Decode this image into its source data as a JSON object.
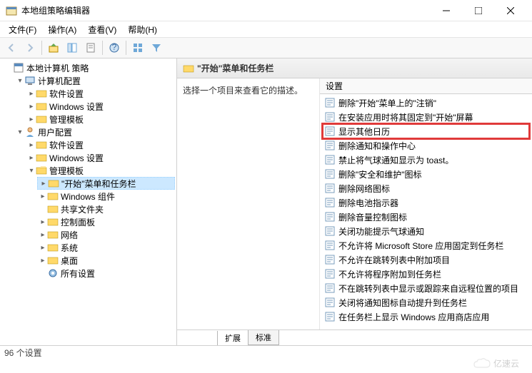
{
  "window": {
    "title": "本地组策略编辑器"
  },
  "menubar": {
    "file": "文件(F)",
    "action": "操作(A)",
    "view": "查看(V)",
    "help": "帮助(H)"
  },
  "tree": {
    "root": "本地计算机 策略",
    "computer_config": "计算机配置",
    "cc_software": "软件设置",
    "cc_windows": "Windows 设置",
    "cc_templates": "管理模板",
    "user_config": "用户配置",
    "uc_software": "软件设置",
    "uc_windows": "Windows 设置",
    "uc_templates": "管理模板",
    "start_taskbar": "\"开始\"菜单和任务栏",
    "windows_components": "Windows 组件",
    "shared_folders": "共享文件夹",
    "control_panel": "控制面板",
    "network": "网络",
    "system": "系统",
    "desktop": "桌面",
    "all_settings": "所有设置"
  },
  "right": {
    "header": "\"开始\"菜单和任务栏",
    "description_prompt": "选择一个项目来查看它的描述。",
    "column_header": "设置",
    "tabs": {
      "extended": "扩展",
      "standard": "标准"
    }
  },
  "settings_list": [
    "删除\"开始\"菜单上的\"注销\"",
    "在安装应用时将其固定到\"开始\"屏幕",
    "显示其他日历",
    "删除通知和操作中心",
    "禁止将气球通知显示为 toast。",
    "删除\"安全和维护\"图标",
    "删除网络图标",
    "删除电池指示器",
    "删除音量控制图标",
    "关闭功能提示气球通知",
    "不允许将 Microsoft Store 应用固定到任务栏",
    "不允许在跳转列表中附加项目",
    "不允许将程序附加到任务栏",
    "不在跳转列表中显示或跟踪来自远程位置的项目",
    "关闭将通知图标自动提升到任务栏",
    "在任务栏上显示 Windows 应用商店应用"
  ],
  "highlight_index": 2,
  "status": "96 个设置"
}
